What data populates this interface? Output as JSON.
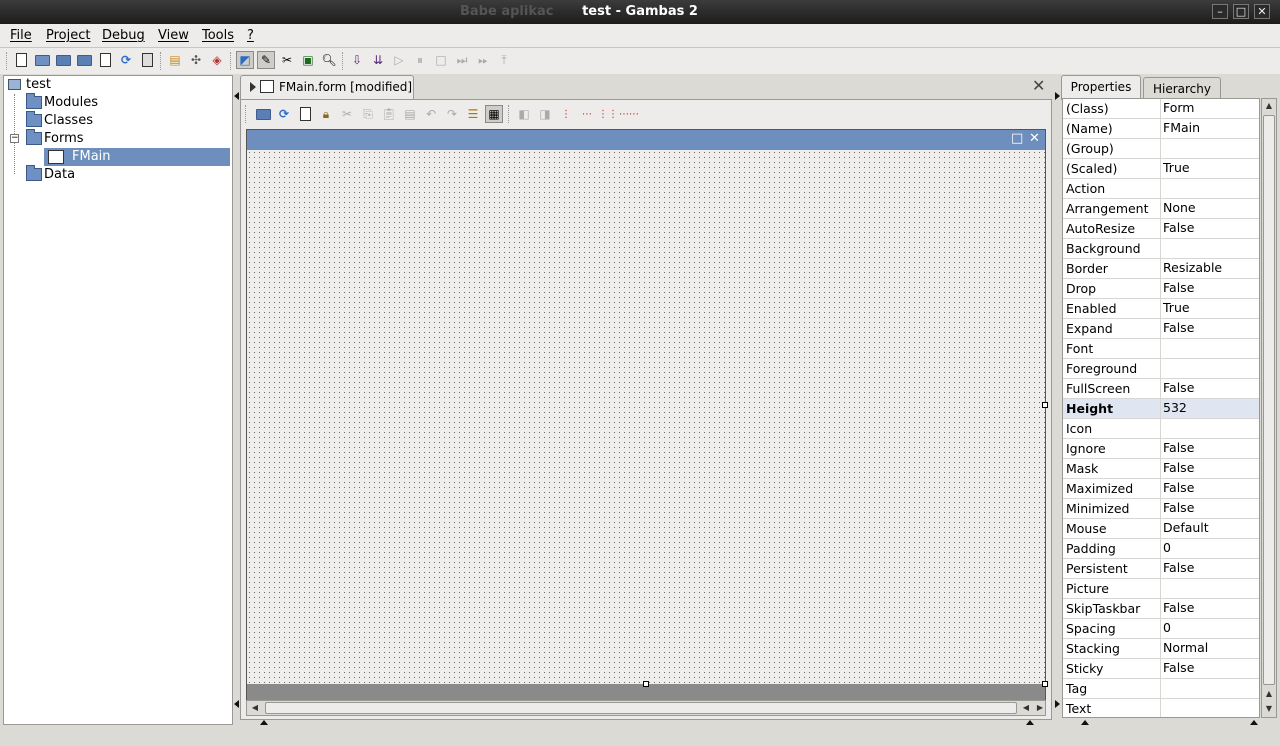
{
  "window": {
    "ghost_title": "Babe aplikac",
    "title": "test - Gambas 2",
    "controls": [
      "–",
      "□",
      "✕"
    ]
  },
  "menubar": {
    "items": [
      "File",
      "Project",
      "Debug",
      "View",
      "Tools",
      "?"
    ]
  },
  "project_tree": {
    "root": "test",
    "items": [
      {
        "label": "Modules"
      },
      {
        "label": "Classes"
      },
      {
        "label": "Forms",
        "expanded": true
      },
      {
        "label": "FMain",
        "selected": true
      },
      {
        "label": "Data"
      }
    ]
  },
  "editor": {
    "tab_label": "FMain.form [modified]",
    "form_title_buttons": [
      "□",
      "✕"
    ]
  },
  "right_panel": {
    "tabs": [
      "Properties",
      "Hierarchy"
    ],
    "active_tab": "Properties",
    "properties": [
      {
        "name": "(Class)",
        "value": "Form"
      },
      {
        "name": "(Name)",
        "value": "FMain"
      },
      {
        "name": "(Group)",
        "value": ""
      },
      {
        "name": "(Scaled)",
        "value": "True"
      },
      {
        "name": "Action",
        "value": ""
      },
      {
        "name": "Arrangement",
        "value": "None"
      },
      {
        "name": "AutoResize",
        "value": "False"
      },
      {
        "name": "Background",
        "value": ""
      },
      {
        "name": "Border",
        "value": "Resizable"
      },
      {
        "name": "Drop",
        "value": "False"
      },
      {
        "name": "Enabled",
        "value": "True"
      },
      {
        "name": "Expand",
        "value": "False"
      },
      {
        "name": "Font",
        "value": ""
      },
      {
        "name": "Foreground",
        "value": ""
      },
      {
        "name": "FullScreen",
        "value": "False"
      },
      {
        "name": "Height",
        "value": "532",
        "highlighted": true
      },
      {
        "name": "Icon",
        "value": ""
      },
      {
        "name": "Ignore",
        "value": "False"
      },
      {
        "name": "Mask",
        "value": "False"
      },
      {
        "name": "Maximized",
        "value": "False"
      },
      {
        "name": "Minimized",
        "value": "False"
      },
      {
        "name": "Mouse",
        "value": "Default"
      },
      {
        "name": "Padding",
        "value": "0"
      },
      {
        "name": "Persistent",
        "value": "False"
      },
      {
        "name": "Picture",
        "value": ""
      },
      {
        "name": "SkipTaskbar",
        "value": "False"
      },
      {
        "name": "Spacing",
        "value": "0"
      },
      {
        "name": "Stacking",
        "value": "Normal"
      },
      {
        "name": "Sticky",
        "value": "False"
      },
      {
        "name": "Tag",
        "value": ""
      },
      {
        "name": "Text",
        "value": ""
      }
    ]
  },
  "colors": {
    "selection": "#6e8fbd",
    "window_bg": "#dcdad5",
    "highlight_row": "#dfe6f1"
  }
}
